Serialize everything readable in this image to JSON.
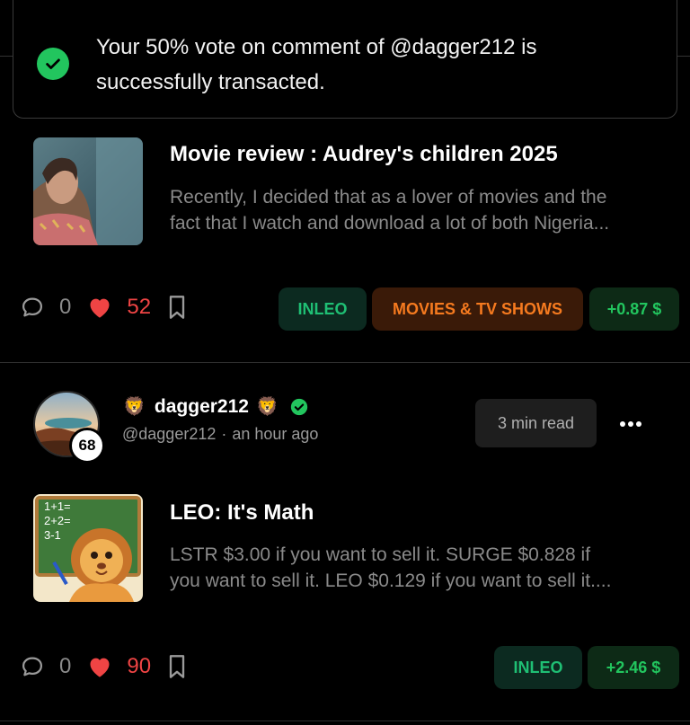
{
  "toast": {
    "line1": "Your 50% vote on comment of @dagger212 is",
    "line2": "successfully transacted."
  },
  "posts": [
    {
      "title": "Movie review : Audrey's children 2025",
      "excerpt_line1": "Recently, I decided that as a lover of movies and the",
      "excerpt_line2": "fact that I watch and download a lot of both Nigeria...",
      "comments": "0",
      "likes": "52",
      "tags": [
        "INLEO",
        "MOVIES & TV SHOWS"
      ],
      "payout": "+0.87 $"
    },
    {
      "author": {
        "name": "dagger212",
        "emoji": "🦁",
        "handle": "@dagger212",
        "time": "an hour ago",
        "reputation": "68"
      },
      "read_time": "3 min read",
      "title": "LEO: It's Math",
      "thumb_text": [
        "1+1=",
        "2+2=",
        "3-1"
      ],
      "excerpt_line1": "LSTR $3.00 if you want to sell it. SURGE $0.828 if",
      "excerpt_line2": "you want to sell it. LEO $0.129 if you want to sell it....",
      "comments": "0",
      "likes": "90",
      "tags": [
        "INLEO"
      ],
      "payout": "+2.46 $"
    }
  ],
  "colors": {
    "accent_green": "#22c55e",
    "like_red": "#ef4444",
    "tag_orange": "#f57a1f"
  },
  "icons": [
    "check-icon",
    "comment-icon",
    "heart-icon",
    "bookmark-icon",
    "verified-icon",
    "more-icon"
  ]
}
